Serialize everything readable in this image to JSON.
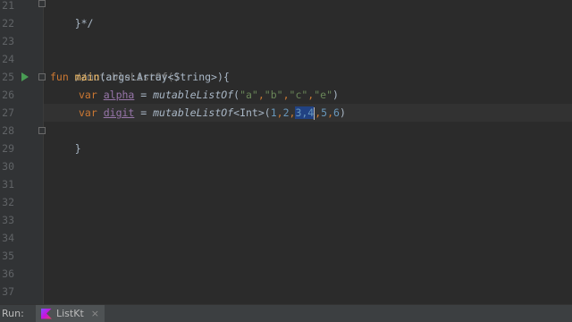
{
  "gutter": {
    "line_numbers": [
      "21",
      "22",
      "23",
      "24",
      "25",
      "26",
      "27",
      "28",
      "29",
      "30",
      "31",
      "32",
      "33",
      "34",
      "35",
      "36",
      "37"
    ]
  },
  "code": {
    "l21": "}*/",
    "l24": "//mutableListOf()",
    "l25": {
      "kw": "fun",
      "name": "main",
      "params": "(args:Array<String>){"
    },
    "l26": {
      "kw": "var",
      "var": "alpha",
      "eq": " = ",
      "fn": "mutableListOf",
      "open": "(",
      "s1": "\"a\"",
      "c1": ",",
      "s2": "\"b\"",
      "c2": ",",
      "s3": "\"c\"",
      "c3": ",",
      "s4": "\"e\"",
      "close": ")"
    },
    "l27": {
      "kw": "var",
      "var": "digit",
      "eq": " = ",
      "fn": "mutableListOf",
      "gen": "<Int>",
      "open": "(",
      "n1": "1",
      "c1": ",",
      "n2": "2",
      "c2": ",",
      "sel": "3,4",
      "c3": ",",
      "n5": "5",
      "c4": ",",
      "n6": "6",
      "close": ")"
    },
    "l28": "}"
  },
  "runbar": {
    "label": "Run:",
    "tab_label": "ListKt",
    "close_glyph": "×"
  },
  "colors": {
    "keyword": "#cc7832",
    "function": "#ffc66d",
    "string": "#6a8759",
    "number": "#6897bb",
    "comment": "#808080",
    "variable": "#9876aa",
    "selection": "#214283"
  }
}
